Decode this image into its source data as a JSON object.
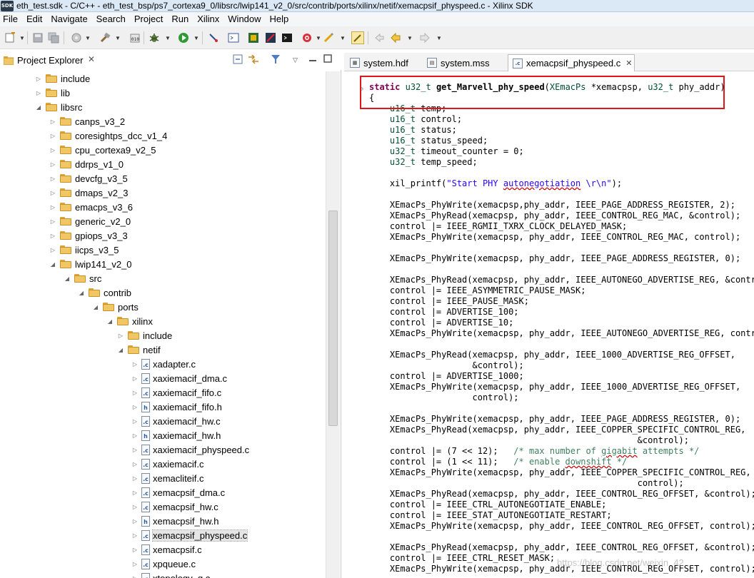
{
  "window": {
    "title": "eth_test.sdk - C/C++ - eth_test_bsp/ps7_cortexa9_0/libsrc/lwip141_v2_0/src/contrib/ports/xilinx/netif/xemacpsif_physpeed.c - Xilinx SDK",
    "logo": "SDK"
  },
  "menu": [
    "File",
    "Edit",
    "Navigate",
    "Search",
    "Project",
    "Run",
    "Xilinx",
    "Window",
    "Help"
  ],
  "toolbar_icons": [
    "new-icon",
    "save-icon",
    "save-all-icon",
    "print-icon",
    "build-icon",
    "program-icon",
    "debug-icon",
    "run-icon",
    "external-tools-icon",
    "terminal-icon",
    "fpga-icon",
    "sdk-icon",
    "console-icon",
    "profile-icon",
    "marker-icon",
    "highlight-icon",
    "back-icon",
    "forward-icon"
  ],
  "project_explorer": {
    "title": "Project Explorer",
    "close": "✕",
    "tree": [
      {
        "label": "include",
        "kind": "folder",
        "twisty": "▷"
      },
      {
        "label": "lib",
        "kind": "folder",
        "twisty": "▷"
      },
      {
        "label": "libsrc",
        "kind": "folder",
        "twisty": "◢"
      },
      {
        "label": "canps_v3_2",
        "kind": "folder",
        "twisty": "▷"
      },
      {
        "label": "coresightps_dcc_v1_4",
        "kind": "folder",
        "twisty": "▷"
      },
      {
        "label": "cpu_cortexa9_v2_5",
        "kind": "folder",
        "twisty": "▷"
      },
      {
        "label": "ddrps_v1_0",
        "kind": "folder",
        "twisty": "▷"
      },
      {
        "label": "devcfg_v3_5",
        "kind": "folder",
        "twisty": "▷"
      },
      {
        "label": "dmaps_v2_3",
        "kind": "folder",
        "twisty": "▷"
      },
      {
        "label": "emacps_v3_6",
        "kind": "folder",
        "twisty": "▷"
      },
      {
        "label": "generic_v2_0",
        "kind": "folder",
        "twisty": "▷"
      },
      {
        "label": "gpiops_v3_3",
        "kind": "folder",
        "twisty": "▷"
      },
      {
        "label": "iicps_v3_5",
        "kind": "folder",
        "twisty": "▷"
      },
      {
        "label": "lwip141_v2_0",
        "kind": "folder",
        "twisty": "◢"
      },
      {
        "label": "src",
        "kind": "folder",
        "twisty": "◢"
      },
      {
        "label": "contrib",
        "kind": "folder",
        "twisty": "◢"
      },
      {
        "label": "ports",
        "kind": "folder",
        "twisty": "◢"
      },
      {
        "label": "xilinx",
        "kind": "folder",
        "twisty": "◢"
      },
      {
        "label": "include",
        "kind": "folder",
        "twisty": "▷"
      },
      {
        "label": "netif",
        "kind": "folder",
        "twisty": "◢"
      },
      {
        "label": "xadapter.c",
        "kind": "c",
        "twisty": "▷"
      },
      {
        "label": "xaxiemacif_dma.c",
        "kind": "c",
        "twisty": "▷"
      },
      {
        "label": "xaxiemacif_fifo.c",
        "kind": "c",
        "twisty": "▷"
      },
      {
        "label": "xaxiemacif_fifo.h",
        "kind": "h",
        "twisty": "▷"
      },
      {
        "label": "xaxiemacif_hw.c",
        "kind": "c",
        "twisty": "▷"
      },
      {
        "label": "xaxiemacif_hw.h",
        "kind": "h",
        "twisty": "▷"
      },
      {
        "label": "xaxiemacif_physpeed.c",
        "kind": "c",
        "twisty": "▷"
      },
      {
        "label": "xaxiemacif.c",
        "kind": "c",
        "twisty": "▷"
      },
      {
        "label": "xemacliteif.c",
        "kind": "c",
        "twisty": "▷"
      },
      {
        "label": "xemacpsif_dma.c",
        "kind": "c",
        "twisty": "▷"
      },
      {
        "label": "xemacpsif_hw.c",
        "kind": "c",
        "twisty": "▷"
      },
      {
        "label": "xemacpsif_hw.h",
        "kind": "h",
        "twisty": "▷"
      },
      {
        "label": "xemacpsif_physpeed.c",
        "kind": "c",
        "twisty": "▷",
        "selected": true
      },
      {
        "label": "xemacpsif.c",
        "kind": "c",
        "twisty": "▷"
      },
      {
        "label": "xpqueue.c",
        "kind": "c",
        "twisty": "▷"
      },
      {
        "label": "xtopology_g.c",
        "kind": "c",
        "twisty": "▷"
      }
    ]
  },
  "editor": {
    "tabs": [
      {
        "label": "system.hdf",
        "icon": "hdf-file-icon",
        "active": false
      },
      {
        "label": "system.mss",
        "icon": "mss-file-icon",
        "active": false
      },
      {
        "label": "xemacpsif_physpeed.c",
        "icon": "c-file-icon",
        "active": true,
        "close": "✕"
      }
    ],
    "code_lines": [
      "static u32_t get_Marvell_phy_speed(XEmacPs *xemacpsp, u32_t phy_addr)",
      "{",
      "    u16_t temp;",
      "    u16_t control;",
      "    u16_t status;",
      "    u16_t status_speed;",
      "    u32_t timeout_counter = 0;",
      "    u32_t temp_speed;",
      "",
      "    xil_printf(\"Start PHY autonegotiation \\r\\n\");",
      "",
      "    XEmacPs_PhyWrite(xemacpsp,phy_addr, IEEE_PAGE_ADDRESS_REGISTER, 2);",
      "    XEmacPs_PhyRead(xemacpsp, phy_addr, IEEE_CONTROL_REG_MAC, &control);",
      "    control |= IEEE_RGMII_TXRX_CLOCK_DELAYED_MASK;",
      "    XEmacPs_PhyWrite(xemacpsp, phy_addr, IEEE_CONTROL_REG_MAC, control);",
      "",
      "    XEmacPs_PhyWrite(xemacpsp, phy_addr, IEEE_PAGE_ADDRESS_REGISTER, 0);",
      "",
      "    XEmacPs_PhyRead(xemacpsp, phy_addr, IEEE_AUTONEGO_ADVERTISE_REG, &control);",
      "    control |= IEEE_ASYMMETRIC_PAUSE_MASK;",
      "    control |= IEEE_PAUSE_MASK;",
      "    control |= ADVERTISE_100;",
      "    control |= ADVERTISE_10;",
      "    XEmacPs_PhyWrite(xemacpsp, phy_addr, IEEE_AUTONEGO_ADVERTISE_REG, control);",
      "",
      "    XEmacPs_PhyRead(xemacpsp, phy_addr, IEEE_1000_ADVERTISE_REG_OFFSET,",
      "                    &control);",
      "    control |= ADVERTISE_1000;",
      "    XEmacPs_PhyWrite(xemacpsp, phy_addr, IEEE_1000_ADVERTISE_REG_OFFSET,",
      "                    control);",
      "",
      "    XEmacPs_PhyWrite(xemacpsp, phy_addr, IEEE_PAGE_ADDRESS_REGISTER, 0);",
      "    XEmacPs_PhyRead(xemacpsp, phy_addr, IEEE_COPPER_SPECIFIC_CONTROL_REG,",
      "                                                    &control);",
      "    control |= (7 << 12);   /* max number of gigabit attempts */",
      "    control |= (1 << 11);   /* enable downshift */",
      "    XEmacPs_PhyWrite(xemacpsp, phy_addr, IEEE_COPPER_SPECIFIC_CONTROL_REG,",
      "                                                    control);",
      "    XEmacPs_PhyRead(xemacpsp, phy_addr, IEEE_CONTROL_REG_OFFSET, &control);",
      "    control |= IEEE_CTRL_AUTONEGOTIATE_ENABLE;",
      "    control |= IEEE_STAT_AUTONEGOTIATE_RESTART;",
      "    XEmacPs_PhyWrite(xemacpsp, phy_addr, IEEE_CONTROL_REG_OFFSET, control);",
      "",
      "    XEmacPs_PhyRead(xemacpsp, phy_addr, IEEE_CONTROL_REG_OFFSET, &control);",
      "    control |= IEEE_CTRL_RESET_MASK;",
      "    XEmacPs_PhyWrite(xemacpsp, phy_addr, IEEE_CONTROL_REG_OFFSET, control);"
    ]
  },
  "watermark": "https://blog.csdn.net/weixin_42..."
}
